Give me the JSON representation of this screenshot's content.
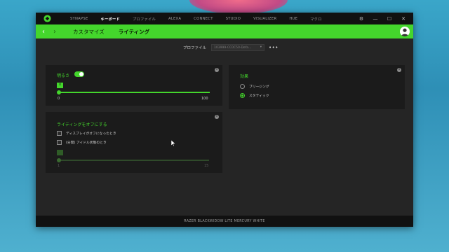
{
  "nav": {
    "items": [
      "SYNAPSE",
      "キーボード",
      "プロファイル",
      "ALEXA",
      "CONNECT",
      "STUDIO",
      "VISUALIZER",
      "HUE",
      "マクロ"
    ],
    "active_index": 1
  },
  "window_controls": {
    "settings": "⚙",
    "minimize": "—",
    "maximize": "☐",
    "close": "✕"
  },
  "subnav": {
    "back": "‹",
    "forward": "›",
    "tabs": [
      "カスタマイズ",
      "ライティング"
    ],
    "active_index": 1
  },
  "profile": {
    "label": "プロファイル",
    "selected": "103999-CC0C50-Defa...",
    "more": "•••"
  },
  "brightness": {
    "title": "明るさ",
    "enabled": true,
    "value": "0",
    "min_label": "0",
    "max_label": "100"
  },
  "effect": {
    "title": "効果",
    "options": [
      "ブリージング",
      "スタティック"
    ],
    "selected_index": 1
  },
  "lighting_off": {
    "title": "ライティングをオフにする",
    "options": [
      "ディスプレイがオフになったとき",
      "(分間) アイドル状態のとき"
    ],
    "min_label": "1",
    "max_label": "15"
  },
  "device_name": "RAZER BLACKWIDOW LITE MERCURY WHITE",
  "colors": {
    "accent": "#44d62c",
    "background": "#222222",
    "panel": "#1b1b1b",
    "titlebar": "#111111"
  }
}
